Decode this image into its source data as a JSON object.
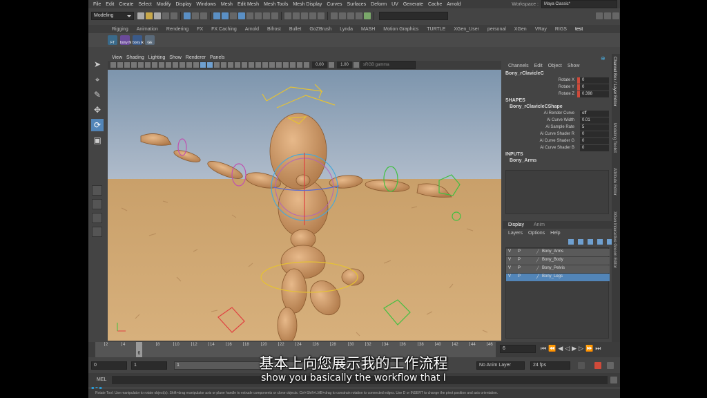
{
  "menubar": {
    "items": [
      "File",
      "Edit",
      "Create",
      "Select",
      "Modify",
      "Display",
      "Windows",
      "Mesh",
      "Edit Mesh",
      "Mesh Tools",
      "Mesh Display",
      "Curves",
      "Surfaces",
      "Deform",
      "UV",
      "Generate",
      "Cache",
      "Arnold"
    ],
    "workspace_label": "Workspace :",
    "workspace_value": "Maya Classic*"
  },
  "statusline": {
    "mode": "Modeling"
  },
  "shelf": {
    "tabs": [
      "Rigging",
      "Animation",
      "Rendering",
      "FX",
      "FX Caching",
      "Arnold",
      "Bifrost",
      "Bullet",
      "GoZBrush",
      "Lynda",
      "MASH",
      "Motion Graphics",
      "TURTLE",
      "XGen_User",
      "personal",
      "XGen",
      "VRay",
      "RIGS",
      "test"
    ],
    "active_tab": "test",
    "buttons": [
      "FT",
      "bony fk",
      "bony ik",
      "GE"
    ]
  },
  "viewport": {
    "menus": [
      "View",
      "Shading",
      "Lighting",
      "Show",
      "Renderer",
      "Panels"
    ],
    "field_a": "0.00",
    "field_b": "1.00",
    "colorspace": "sRGB gamma"
  },
  "channelbox": {
    "tabs": [
      "Channels",
      "Edit",
      "Object",
      "Show"
    ],
    "node": "Bony_rClavicleC",
    "channels": [
      {
        "label": "Rotate X",
        "value": "0"
      },
      {
        "label": "Rotate Y",
        "value": "0"
      },
      {
        "label": "Rotate Z",
        "value": "0.398"
      }
    ],
    "shapes_header": "SHAPES",
    "shape_node": "Bony_rClavicleCShape",
    "shape_attrs": [
      {
        "label": "Ai Render Curve",
        "value": "off"
      },
      {
        "label": "Ai Curve Width",
        "value": "0.01"
      },
      {
        "label": "Ai Sample Rate",
        "value": "5"
      },
      {
        "label": "Ai Curve Shader R",
        "value": "0"
      },
      {
        "label": "Ai Curve Shader G",
        "value": "0"
      },
      {
        "label": "Ai Curve Shader B",
        "value": "0"
      }
    ],
    "inputs_header": "INPUTS",
    "input_node": "Bony_Arms"
  },
  "layers": {
    "tabs": [
      "Display",
      "Anim"
    ],
    "menus": [
      "Layers",
      "Options",
      "Help"
    ],
    "rows": [
      {
        "v": "V",
        "p": "P",
        "name": "Bony_Arms",
        "selected": false
      },
      {
        "v": "V",
        "p": "P",
        "name": "Bony_Body",
        "selected": false
      },
      {
        "v": "V",
        "p": "P",
        "name": "Bony_Pelvis",
        "selected": false
      },
      {
        "v": "V",
        "p": "P",
        "name": "Bony_Legs",
        "selected": true
      }
    ]
  },
  "sidetabs": [
    "Channel Box / Layer Editor",
    "Modeling Toolkit",
    "Attribute Editor",
    "XGen Interactive Groom Editor"
  ],
  "timeline": {
    "ticks": [
      "2",
      "4",
      "6",
      "8",
      "10",
      "12",
      "14",
      "16",
      "18",
      "20",
      "22",
      "24",
      "26",
      "28",
      "30",
      "32",
      "34",
      "36",
      "38",
      "40",
      "42",
      "44",
      "46"
    ],
    "current_frame": "6",
    "frame_field": "6",
    "current_frame_index": 2
  },
  "range": {
    "start": "0",
    "inner_start": "1",
    "slider_label": "1",
    "anim_layer": "No Anim Layer",
    "fps": "24 fps"
  },
  "cmdline": {
    "label": "MEL"
  },
  "helpline": "Rotate Tool: Use manipulator to rotate object(s). Shift+drag manipulator axis or plane handle to extrude components or clone objects. Ctrl+Shift+LMB+drag to constrain rotation to connected edges. Use D or INSERT to change the pivot position and axis orientation.",
  "subtitles": {
    "cn": "基本上向您展示我的工作流程",
    "en": "show you basically the workflow that I"
  },
  "colors": {
    "accent": "#5285b8",
    "maya_logo": "#2a9bd6",
    "key_red": "#d04a3a"
  }
}
